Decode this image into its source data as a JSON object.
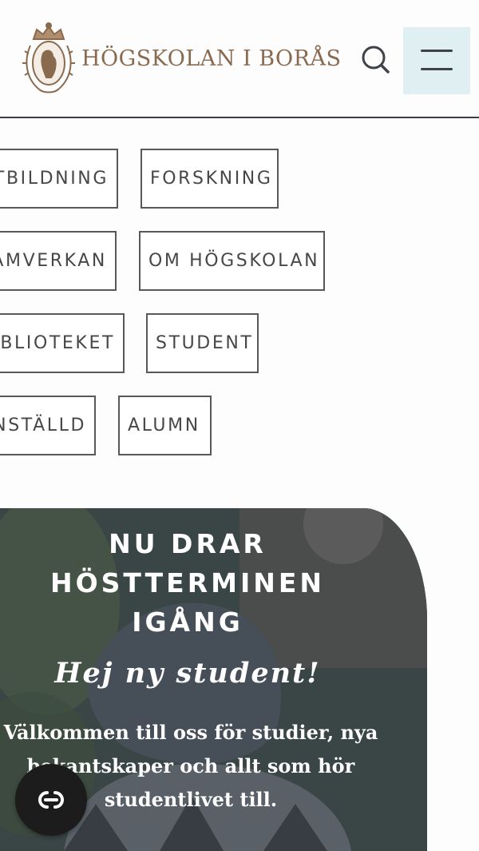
{
  "header": {
    "logo_text": "HÖGSKOLAN I BORÅS"
  },
  "nav": {
    "items": [
      {
        "label": "UTBILDNING"
      },
      {
        "label": "FORSKNING"
      },
      {
        "label": "SAMVERKAN"
      },
      {
        "label": "OM HÖGSKOLAN"
      },
      {
        "label": "BIBLIOTEKET"
      },
      {
        "label": "STUDENT"
      },
      {
        "label": "ANSTÄLLD"
      },
      {
        "label": "ALUMN"
      }
    ]
  },
  "hero": {
    "title": "NU DRAR HÖSTTERMINEN IGÅNG",
    "subtitle": "Hej ny student!",
    "body": "Välkommen till oss för studier, nya bekantskaper och allt som hör studentlivet till."
  },
  "colors": {
    "brand_gold": "#8a6a4f",
    "menu_bg": "#dfeff2",
    "cookie_bg": "#1c1c1c"
  }
}
